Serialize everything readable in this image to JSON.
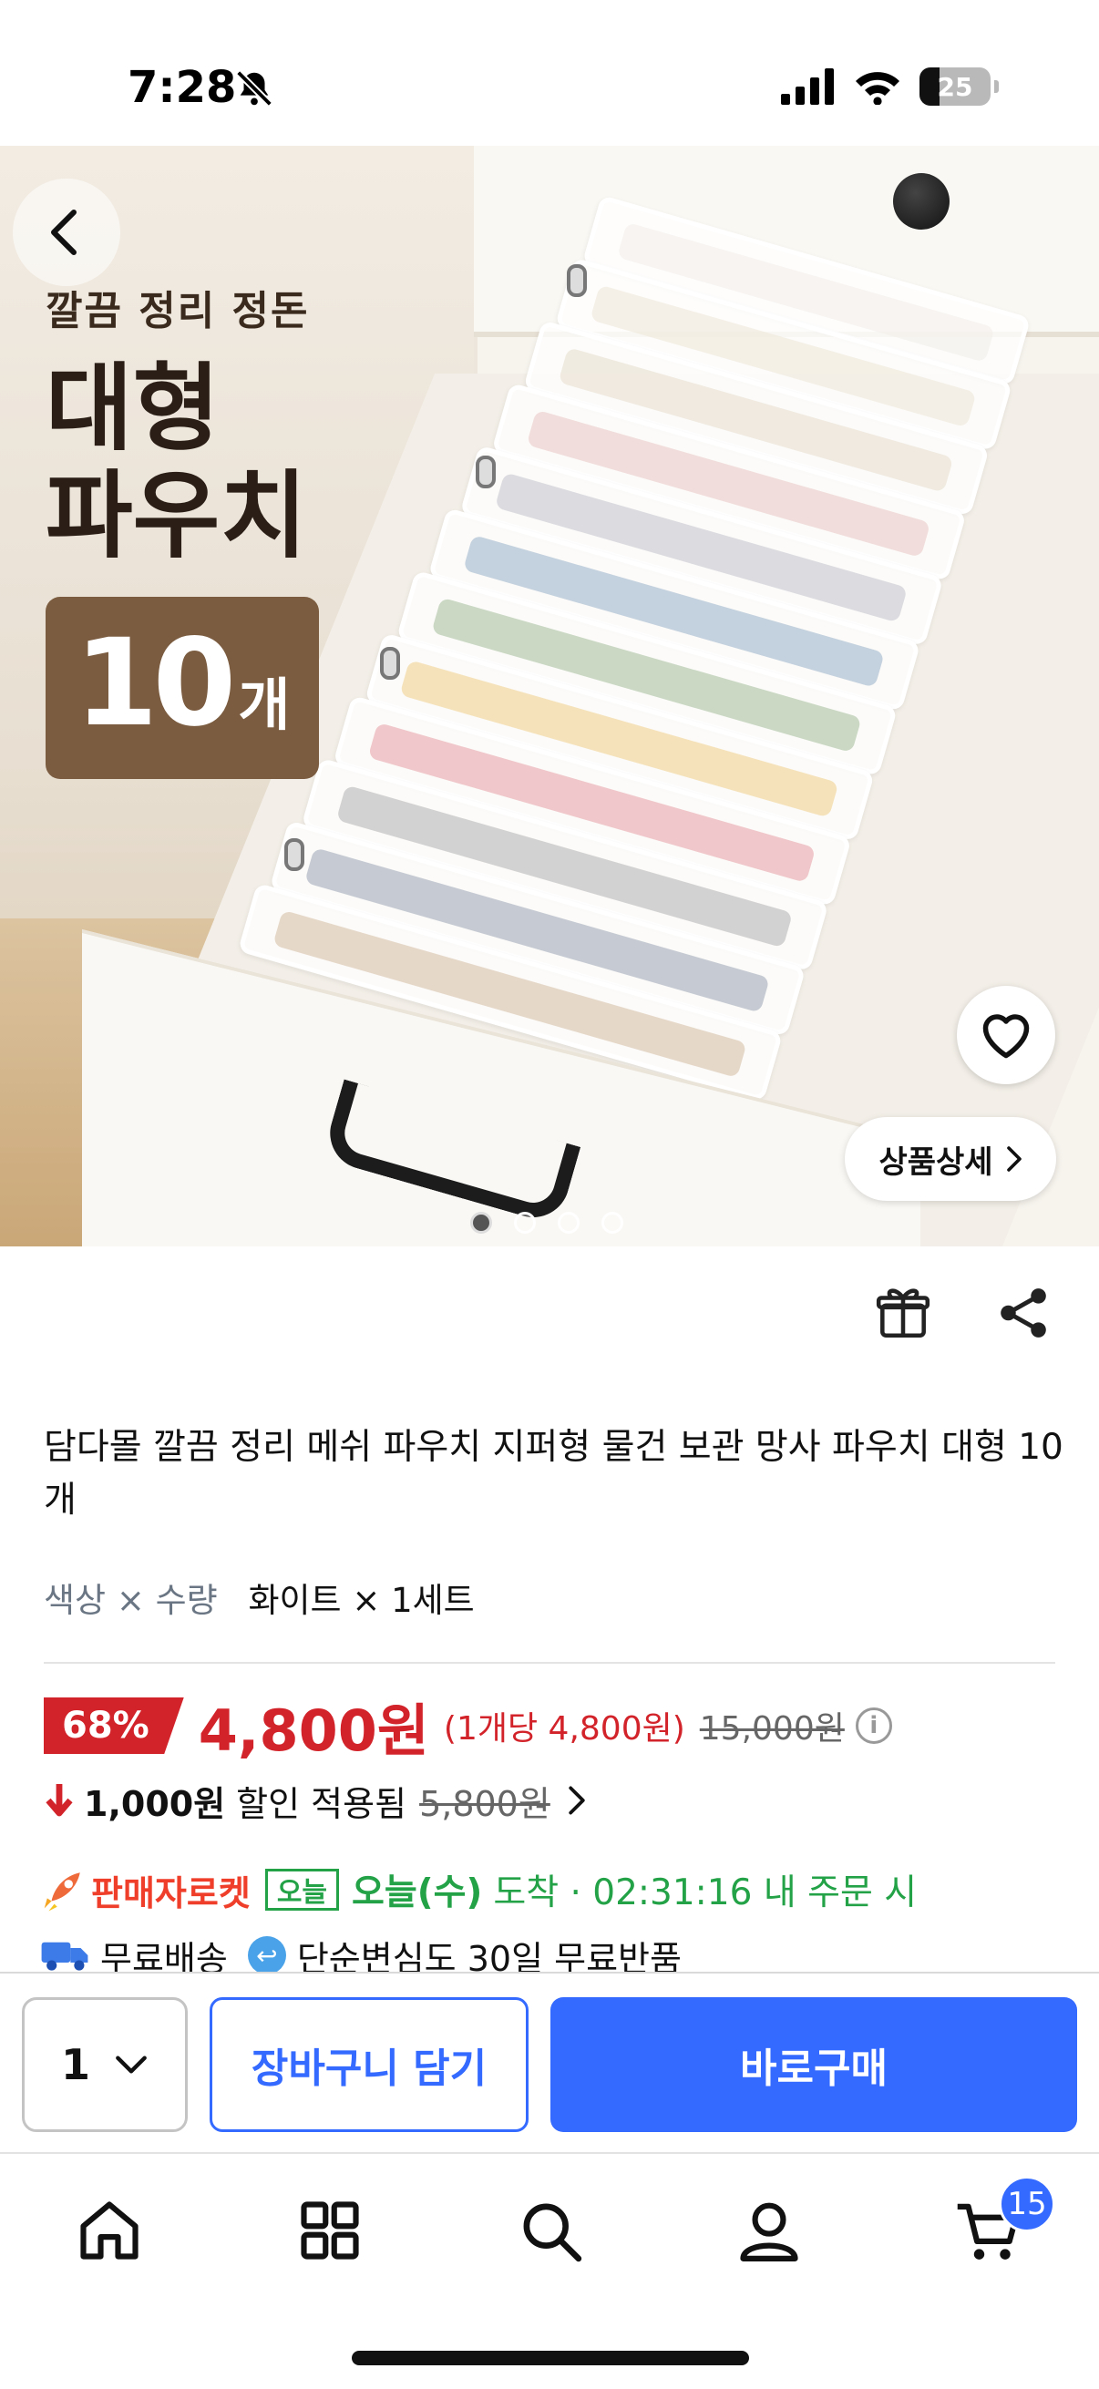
{
  "status_bar": {
    "time": "7:28",
    "battery": "25"
  },
  "hero": {
    "promo_subtitle": "깔끔 정리 정돈",
    "promo_title_line1": "대형",
    "promo_title_line2": "파우치",
    "promo_count": "10",
    "promo_count_unit": "개",
    "detail_button": "상품상세",
    "carousel_total": 4,
    "carousel_active": 1
  },
  "product": {
    "title": "담다몰 깔끔 정리 메쉬 파우치 지퍼형 물건 보관 망사 파우치 대형 10개",
    "option_label": "색상 × 수량",
    "option_value": "화이트 × 1세트"
  },
  "pricing": {
    "discount_rate": "68%",
    "price": "4,800원",
    "unit_price": "(1개당 4,800원)",
    "original_price": "15,000원",
    "coupon_amount": "1,000원",
    "coupon_text": "할인 적용됨",
    "coupon_original": "5,800원"
  },
  "delivery": {
    "seller_rocket": "판매자로켓",
    "today_badge": "오늘",
    "arrive_date": "오늘(수)",
    "arrive_text": "도착 · 02:31:16 내 주문 시",
    "free_shipping": "무료배송",
    "free_return": "단순변심도 30일 무료반품"
  },
  "purchase_bar": {
    "quantity": "1",
    "cart_button": "장바구니 담기",
    "buy_button": "바로구매"
  },
  "tab_bar": {
    "cart_count": "15"
  },
  "colors": {
    "accent_blue": "#346aff",
    "price_red": "#d3232a",
    "rocket_green": "#23a247",
    "seller_rocket_red": "#ef3e2a",
    "promo_badge_brown": "#7b5c40"
  },
  "icons": [
    "bell-off-icon",
    "signal-icon",
    "wifi-icon",
    "battery-icon",
    "back-icon",
    "heart-icon",
    "chevron-right-icon",
    "gift-icon",
    "share-icon",
    "info-icon",
    "arrow-down-icon",
    "rocket-icon",
    "truck-icon",
    "return-icon",
    "chevron-down-icon",
    "home-icon",
    "category-icon",
    "search-icon",
    "user-icon",
    "cart-icon"
  ]
}
